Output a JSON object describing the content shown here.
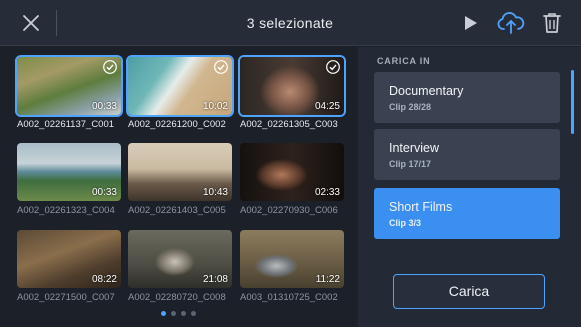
{
  "header": {
    "title": "3 selezionate",
    "icons": {
      "close": "close-icon",
      "play": "play-icon",
      "upload": "cloud-upload-icon",
      "delete": "trash-icon"
    }
  },
  "clips": [
    {
      "name": "A002_02261137_C001",
      "duration": "00:33",
      "selected": true
    },
    {
      "name": "A002_02261200_C002",
      "duration": "10:02",
      "selected": true
    },
    {
      "name": "A002_02261305_C003",
      "duration": "04:25",
      "selected": true
    },
    {
      "name": "A002_02261323_C004",
      "duration": "00:33",
      "selected": false
    },
    {
      "name": "A002_02261403_C005",
      "duration": "10:43",
      "selected": false
    },
    {
      "name": "A002_02270930_C006",
      "duration": "02:33",
      "selected": false
    },
    {
      "name": "A002_02271500_C007",
      "duration": "08:22",
      "selected": false
    },
    {
      "name": "A002_02280720_C008",
      "duration": "21:08",
      "selected": false
    },
    {
      "name": "A003_01310725_C002",
      "duration": "11:22",
      "selected": false
    }
  ],
  "pagination": {
    "pages": 4,
    "current": 1
  },
  "panel": {
    "heading": "CARICA IN",
    "bins": [
      {
        "name": "Documentary",
        "count": "Clip 28/28",
        "active": false
      },
      {
        "name": "Interview",
        "count": "Clip 17/17",
        "active": false
      },
      {
        "name": "Short Films",
        "count": "Clip 3/3",
        "active": true
      }
    ],
    "upload_label": "Carica"
  },
  "colors": {
    "accent": "#4ea3ff",
    "active_bin": "#3a8ff0",
    "background": "#1b2029",
    "panel": "#232a35"
  }
}
